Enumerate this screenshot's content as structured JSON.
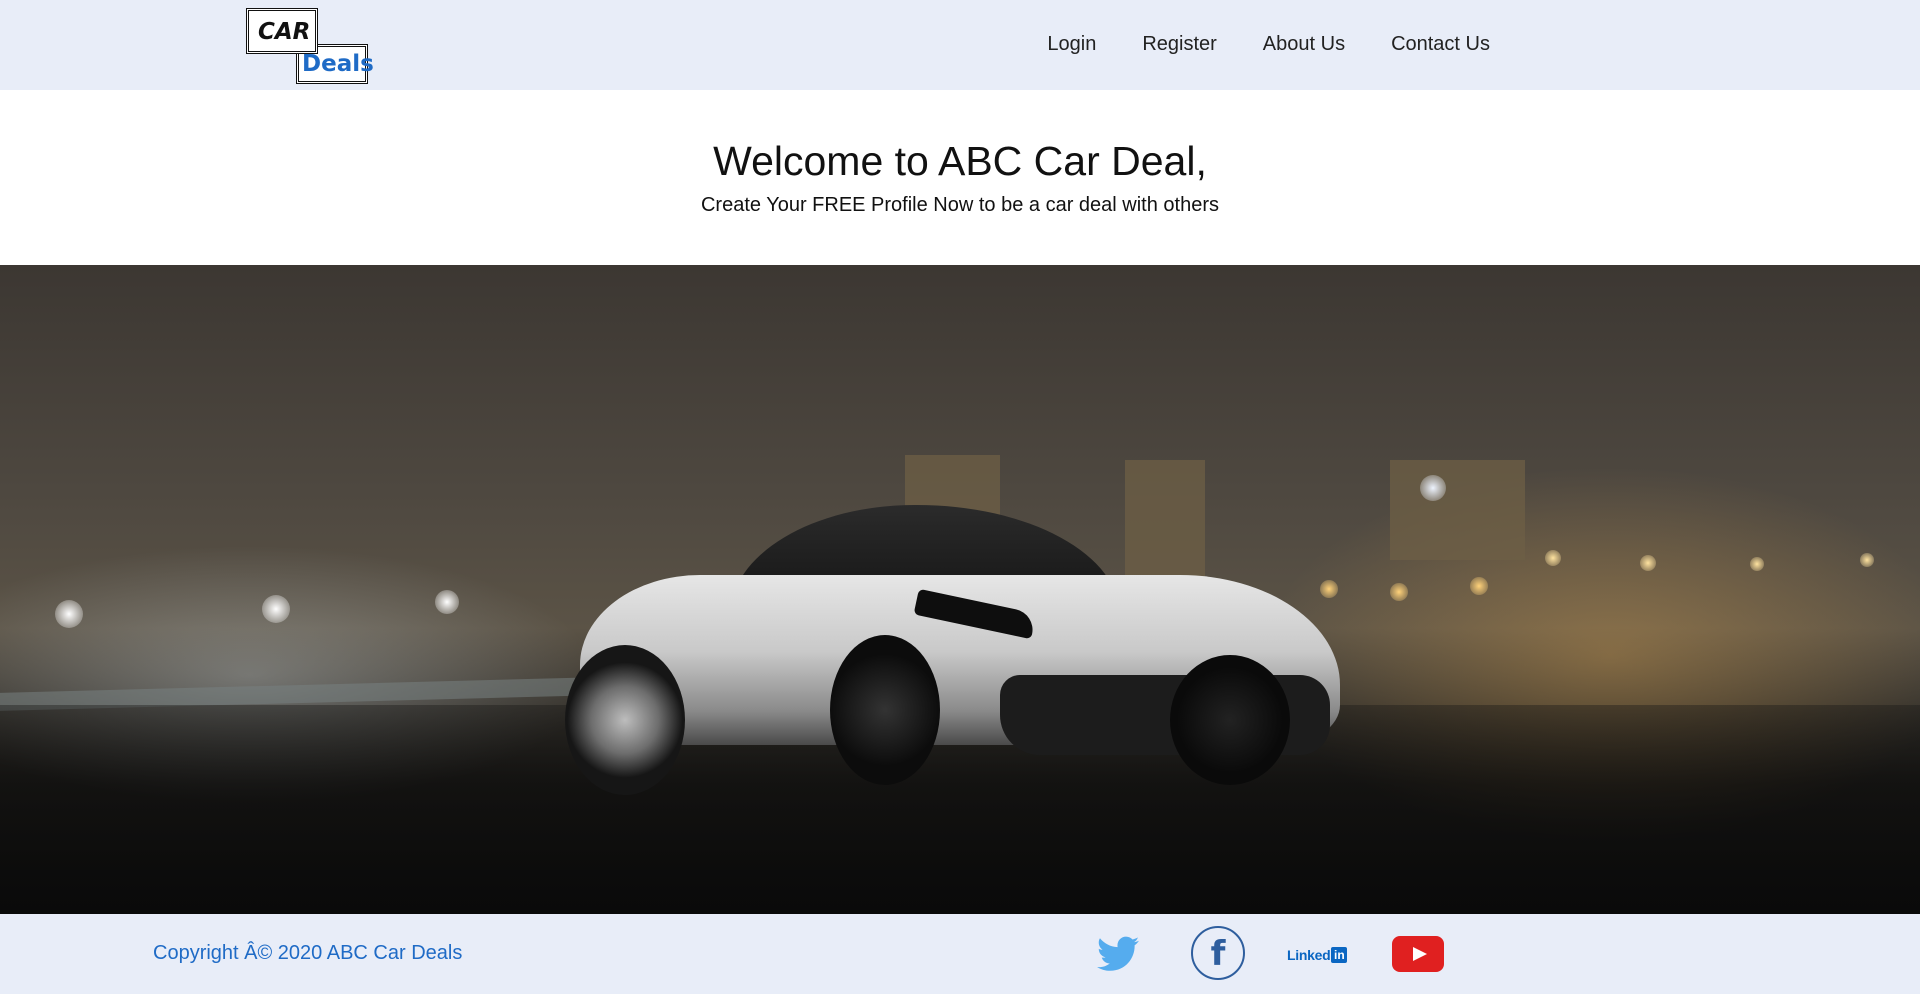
{
  "header": {
    "logo": {
      "line1": "CAR",
      "line2": "Deals"
    },
    "nav": [
      {
        "label": "Login"
      },
      {
        "label": "Register"
      },
      {
        "label": "About Us"
      },
      {
        "label": "Contact Us"
      }
    ]
  },
  "intro": {
    "title": "Welcome to ABC Car Deal,",
    "subtitle": "Create Your FREE Profile Now to be a car deal with others"
  },
  "hero": {
    "image": "white sports car at night on a wet road with city lights"
  },
  "footer": {
    "copyright": "Copyright Â© 2020 ABC Car Deals",
    "social": [
      {
        "name": "twitter-icon"
      },
      {
        "name": "facebook-icon",
        "glyph": "f"
      },
      {
        "name": "linkedin-icon",
        "text": "Linked",
        "badge": "in"
      },
      {
        "name": "youtube-icon"
      }
    ]
  },
  "colors": {
    "bar_background": "#e8edf8",
    "link_blue": "#1f6bc6",
    "twitter": "#55acee",
    "facebook": "#2e5e9e",
    "linkedin": "#0a66c2",
    "youtube": "#e02020"
  }
}
